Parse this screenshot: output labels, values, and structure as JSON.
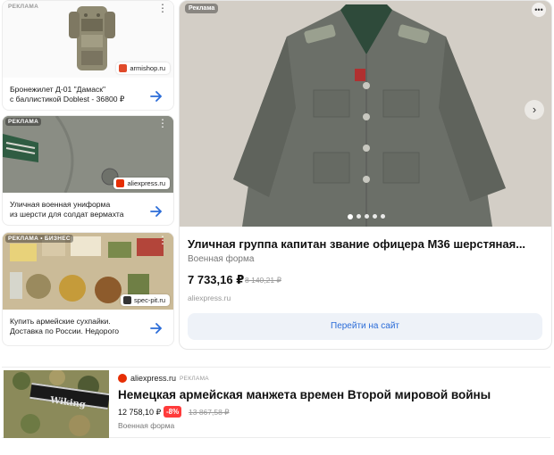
{
  "cards": [
    {
      "ad_label": "РЕКЛАМА",
      "source": "armishop.ru",
      "title_line1": "Бронежилет Д-01 \"Дамаск\"",
      "title_line2": "с баллистикой Doblest - 36800 ₽"
    },
    {
      "ad_label": "РЕКЛАМА",
      "source": "aliexpress.ru",
      "title_line1": "Уличная военная униформа",
      "title_line2": "из шерсти для солдат вермахта"
    },
    {
      "ad_label": "РЕКЛАМА • БИЗНЕС",
      "source": "spec-pit.ru",
      "title_line1": "Купить армейские сухпайки.",
      "title_line2": "Доставка по России. Недорого"
    }
  ],
  "featured": {
    "ad_label": "Реклама",
    "menu_icon": "dots-icon",
    "title": "Уличная группа капитан звание офицера М36 шерстяная...",
    "subtitle": "Военная форма",
    "price": "7 733,16 ₽",
    "old_price": "8 140,21 ₽",
    "domain": "aliexpress.ru",
    "button_label": "Перейти на сайт",
    "next_icon": "›",
    "slides": 5
  },
  "bottom": {
    "source": "aliexpress.ru",
    "ad_label": "РЕКЛАМА",
    "image_text": "Wiking",
    "title": "Немецкая армейская манжета времен Второй мировой войны",
    "price": "12 758,10 ₽",
    "discount": "-8%",
    "old_price": "13 867,58 ₽",
    "subtitle": "Военная форма"
  },
  "colors": {
    "accent_blue": "#2b6cd8",
    "discount_red": "#ff3b3b",
    "ali_red": "#e62e04"
  }
}
